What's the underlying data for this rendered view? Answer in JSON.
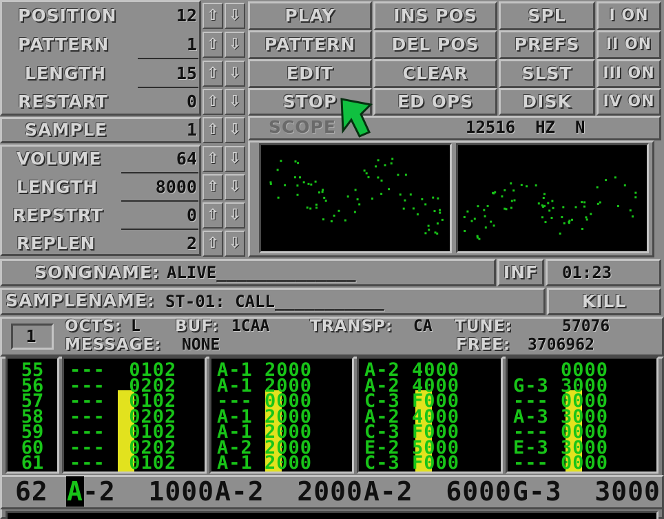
{
  "song": {
    "position_label": "POSITION",
    "position_value": "12",
    "pattern_label": "PATTERN",
    "pattern_value": "1",
    "length_label": "LENGTH",
    "length_value": "15",
    "restart_label": "RESTART",
    "restart_value": "0"
  },
  "arrows": {
    "up": "⇧",
    "down": "⇩"
  },
  "buttons": {
    "play": "PLAY",
    "pattern": "PATTERN",
    "edit": "EDIT",
    "stop": "STOP",
    "ins_pos": "INS POS",
    "del_pos": "DEL POS",
    "clear": "CLEAR",
    "ed_ops": "ED OPS",
    "spl": "SPL",
    "prefs": "PREFS",
    "slst": "SLST",
    "disk": "DISK",
    "inf": "INF",
    "kill": "KILL"
  },
  "channels": [
    "I ON",
    "II ON",
    "III ON",
    "IV ON"
  ],
  "sample": {
    "sample_label": "SAMPLE",
    "sample_value": "1",
    "volume_label": "VOLUME",
    "volume_value": "64",
    "length_label": "LENGTH",
    "length_value": "8000",
    "repstrt_label": "REPSTRT",
    "repstrt_value": "0",
    "replen_label": "REPLEN",
    "replen_value": "2"
  },
  "scope": {
    "label": "SCOPE",
    "freq": "12516  HZ  N"
  },
  "songname": {
    "label": "SONGNAME:",
    "value": "ALIVE______________"
  },
  "samplename": {
    "label": "SAMPLENAME:",
    "value": "ST-01: CALL___________"
  },
  "time": "01:23",
  "status": {
    "octave_box": "1",
    "octs_label": "OCTS:",
    "octs_value": "L",
    "buf_label": "BUF:",
    "buf_value": "1CAA",
    "transp_label": "TRANSP:",
    "transp_value": "CA",
    "tune_label": "TUNE:",
    "tune_value": "57076",
    "message_label": "MESSAGE:",
    "message_value": "NONE",
    "free_label": "FREE:",
    "free_value": "3706962"
  },
  "rows": [
    "55",
    "56",
    "57",
    "58",
    "59",
    "60",
    "61"
  ],
  "tracks": [
    {
      "lines": [
        "---  0102",
        "---  0202",
        "---  0102",
        "---  0202",
        "---  0102",
        "---  0202",
        "---  0102"
      ],
      "vu_level": 0.72
    },
    {
      "lines": [
        "A-1 2000",
        "A-1 2000",
        "--- 0000",
        "A-1 2000",
        "A-1 2000",
        "A-2 2000",
        "A-1 2000"
      ],
      "vu_level": 0.72
    },
    {
      "lines": [
        "A-2 4000",
        "A-2 4000",
        "C-3 F000",
        "A-2 4000",
        "C-3 F000",
        "E-2 5000",
        "C-3 F000"
      ],
      "vu_level": 0.72
    },
    {
      "lines": [
        "    0000",
        "G-3 3000",
        "--- 0000",
        "A-3 3000",
        "--- 0000",
        "E-3 3000",
        "--- 0000"
      ],
      "vu_level": 0.72
    }
  ],
  "current_row": {
    "number": "62",
    "cursor_char": "A",
    "cells": [
      "-2  1000",
      "A-2  2000",
      "A-2  6000",
      "G-3  3000"
    ]
  },
  "colors": {
    "panel": "#8e8e8e",
    "highlight": "#c4c4c4",
    "shadow": "#4a4a4a",
    "label": "#d6d6d6",
    "pattern_text": "#18c418",
    "vu": "#e2e21e",
    "pointer": "#10c040"
  },
  "icons": {
    "pointer": "mouse-pointer-icon"
  }
}
